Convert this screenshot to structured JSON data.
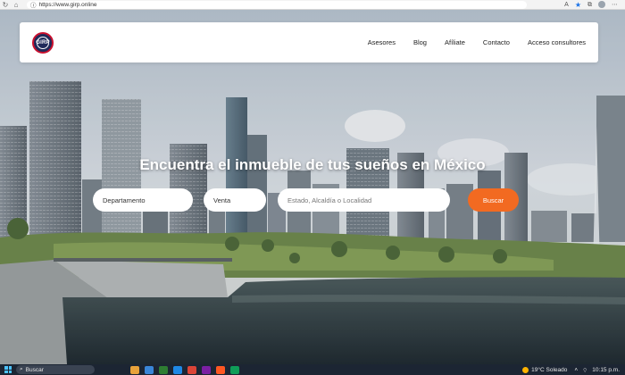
{
  "browser": {
    "url": "https://www.girp.online",
    "lock_icon": "info-circle-icon",
    "star_icon": "star-icon"
  },
  "header": {
    "logo_text": "GIRP",
    "nav": [
      {
        "label": "Asesores"
      },
      {
        "label": "Blog"
      },
      {
        "label": "Afíliate"
      },
      {
        "label": "Contacto"
      },
      {
        "label": "Acceso consultores"
      }
    ]
  },
  "hero": {
    "title": "Encuentra el inmueble de tus sueños en México"
  },
  "search": {
    "property_type": "Departamento",
    "operation": "Venta",
    "location_placeholder": "Estado, Alcaldía o Localidad",
    "button_label": "Buscar"
  },
  "taskbar": {
    "search_label": "Buscar",
    "weather": "19°C  Soleado",
    "clock": "10:15 p.m."
  },
  "colors": {
    "accent": "#f26a21",
    "navbar_bg": "#ffffff",
    "taskbar_bg": "#1c2533"
  }
}
